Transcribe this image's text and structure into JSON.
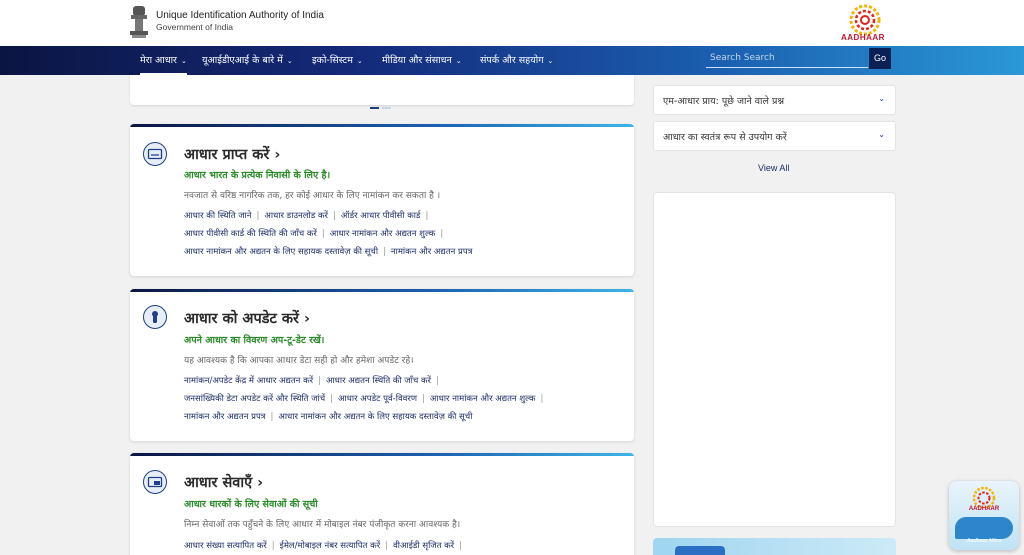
{
  "header": {
    "org_name": "Unique Identification Authority of India",
    "gov_name": "Government of India",
    "logo_text": "AADHAAR"
  },
  "nav": {
    "items": [
      {
        "label": "मेरा आधार"
      },
      {
        "label": "यूआईडीएआई के बारे में"
      },
      {
        "label": "इको-सिस्टम"
      },
      {
        "label": "मीडिया और संसाधन"
      },
      {
        "label": "संपर्क और सहयोग"
      }
    ],
    "search_placeholder": "Search Search",
    "go_label": "Go"
  },
  "cards": [
    {
      "title": "आधार प्राप्त करें ›",
      "tagline": "आधार भारत के प्रत्येक निवासी के लिए है।",
      "description": "नवजात से वरिष्ठ नागरिक तक, हर कोई आधार के लिए नामांकन कर सकता है ।",
      "links": [
        [
          "आधार की स्थिति जाने",
          "आधार डाउनलोड करें",
          "ऑर्डर आधार पीवीसी कार्ड"
        ],
        [
          "आधार पीवीसी कार्ड की स्थिति की जाँच करें",
          "आधार नामांकन और अद्यतन शुल्क"
        ],
        [
          "आधार नामांकन और अद्यतन के लिए सहायक दस्तावेज़ की सूची",
          "नामांकन और अद्यतन प्रपत्र"
        ]
      ]
    },
    {
      "title": "आधार को अपडेट करें ›",
      "tagline": "अपने आधार का विवरण अप-टू-डेट रखें।",
      "description": "यह आवश्यक है कि आपका आधार डेटा सही हो और हमेशा अपडेट रहे।",
      "links": [
        [
          "नामांकन/अपडेट केंद्र में आधार अद्यतन करें",
          "आधार अद्यतन स्थिति की जाँच करें"
        ],
        [
          "जनसांख्यिकी डेटा अपडेट करें और स्थिति जांचें",
          "आधार अपडेट पूर्व-विवरण",
          "आधार नामांकन और अद्यतन शुल्क"
        ],
        [
          "नामांकन और अद्यतन प्रपत्र",
          "आधार नामांकन और अद्यतन के लिए सहायक दस्तावेज़ की सूची"
        ]
      ]
    },
    {
      "title": "आधार सेवाएँ ›",
      "tagline": "आधार धारकों के लिए सेवाओं की सूची",
      "description": "निम्न सेवाओं तक पहुँचने के लिए आधार में मोबाइल नंबर पंजीकृत करना आवश्यक है।",
      "links": [
        [
          "आधार संख्या सत्यापित करें",
          "ईमेल/मोबाइल नंबर सत्यापित करें",
          "वीआईडी सृजित करें"
        ]
      ]
    }
  ],
  "faqs": [
    {
      "label": "एम-आधार प्राय: पूछे जाने वाले प्रश्न"
    },
    {
      "label": "आधार का स्वतंत्र रूप से उपयोग करें"
    }
  ],
  "view_all": "View All",
  "mitra": {
    "label": "AADHAAR",
    "sub": "Aadhaar Mitra"
  },
  "colors": {
    "nav_dark": "#0b1542",
    "nav_light": "#2a98d6",
    "tagline_green": "#2a8a2a",
    "link_blue": "#1d2e66"
  }
}
